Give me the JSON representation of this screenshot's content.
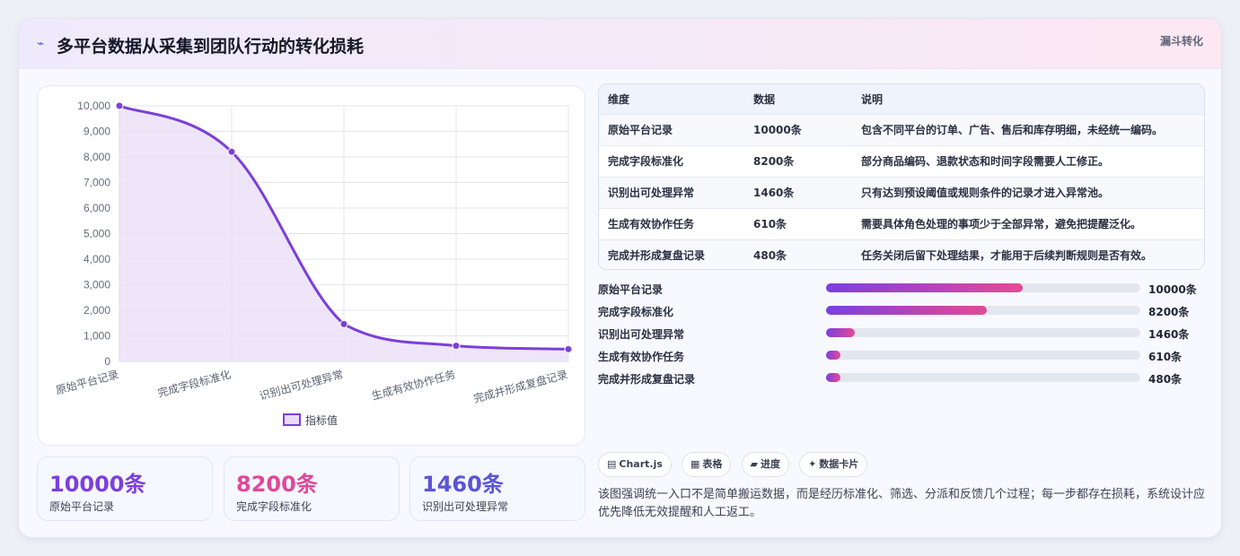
{
  "header": {
    "icon": "chart-line-icon",
    "title": "多平台数据从采集到团队行动的转化损耗",
    "tag": "漏斗转化"
  },
  "chart_data": {
    "type": "line",
    "categories": [
      "原始平台记录",
      "完成字段标准化",
      "识别出可处理异常",
      "生成有效协作任务",
      "完成并形成复盘记录"
    ],
    "series": [
      {
        "name": "指标值",
        "values": [
          10000,
          8200,
          1460,
          610,
          480
        ]
      }
    ],
    "ylim": [
      0,
      10000
    ],
    "yticks": [
      "0",
      "1,000",
      "2,000",
      "3,000",
      "4,000",
      "5,000",
      "6,000",
      "7,000",
      "8,000",
      "9,000",
      "10,000"
    ],
    "legend": "bottom",
    "grid": true,
    "colors": {
      "line": "#7c3fd8",
      "fill": "#e8dcf7"
    }
  },
  "kpis": [
    {
      "value": "10000条",
      "label": "原始平台记录",
      "color": "#7b3fe0"
    },
    {
      "value": "8200条",
      "label": "完成字段标准化",
      "color": "#e0489a"
    },
    {
      "value": "1460条",
      "label": "识别出可处理异常",
      "color": "#5a55d8"
    }
  ],
  "table": {
    "headers": [
      "维度",
      "数据",
      "说明"
    ],
    "rows": [
      [
        "原始平台记录",
        "10000条",
        "包含不同平台的订单、广告、售后和库存明细，未经统一编码。"
      ],
      [
        "完成字段标准化",
        "8200条",
        "部分商品编码、退款状态和时间字段需要人工修正。"
      ],
      [
        "识别出可处理异常",
        "1460条",
        "只有达到预设阈值或规则条件的记录才进入异常池。"
      ],
      [
        "生成有效协作任务",
        "610条",
        "需要具体角色处理的事项少于全部异常，避免把提醒泛化。"
      ],
      [
        "完成并形成复盘记录",
        "480条",
        "任务关闭后留下处理结果，才能用于后续判断规则是否有效。"
      ]
    ]
  },
  "bars": [
    {
      "label": "原始平台记录",
      "value": "10000条",
      "fraction": 0.625
    },
    {
      "label": "完成字段标准化",
      "value": "8200条",
      "fraction": 0.512
    },
    {
      "label": "识别出可处理异常",
      "value": "1460条",
      "fraction": 0.091
    },
    {
      "label": "生成有效协作任务",
      "value": "610条",
      "fraction": 0.045
    },
    {
      "label": "完成并形成复盘记录",
      "value": "480条",
      "fraction": 0.045
    }
  ],
  "chips": [
    {
      "icon": "chart-icon",
      "glyph": "▤",
      "label": "Chart.js"
    },
    {
      "icon": "table-icon",
      "glyph": "▦",
      "label": "表格"
    },
    {
      "icon": "progress-icon",
      "glyph": "▰",
      "label": "进度"
    },
    {
      "icon": "sparkle-icon",
      "glyph": "✦",
      "label": "数据卡片"
    }
  ],
  "note": "该图强调统一入口不是简单搬运数据，而是经历标准化、筛选、分派和反馈几个过程；每一步都存在损耗，系统设计应优先降低无效提醒和人工返工。"
}
